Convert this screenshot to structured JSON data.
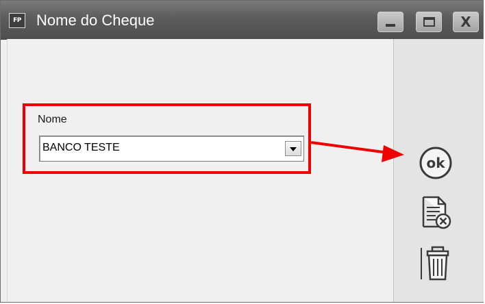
{
  "window": {
    "app_icon_text": "FP",
    "title": "Nome do Cheque",
    "controls": {
      "minimize": "minimize-icon",
      "maximize": "maximize-icon",
      "close": "close-icon",
      "close_glyph": "X"
    }
  },
  "form": {
    "name_label": "Nome",
    "name_value": "BANCO TESTE"
  },
  "side_actions": {
    "ok_label": "ok",
    "ok_icon": "ok-circle-icon",
    "cancel_icon": "document-cancel-icon",
    "delete_icon": "trash-icon"
  },
  "annotation": {
    "color": "#ee0000"
  }
}
